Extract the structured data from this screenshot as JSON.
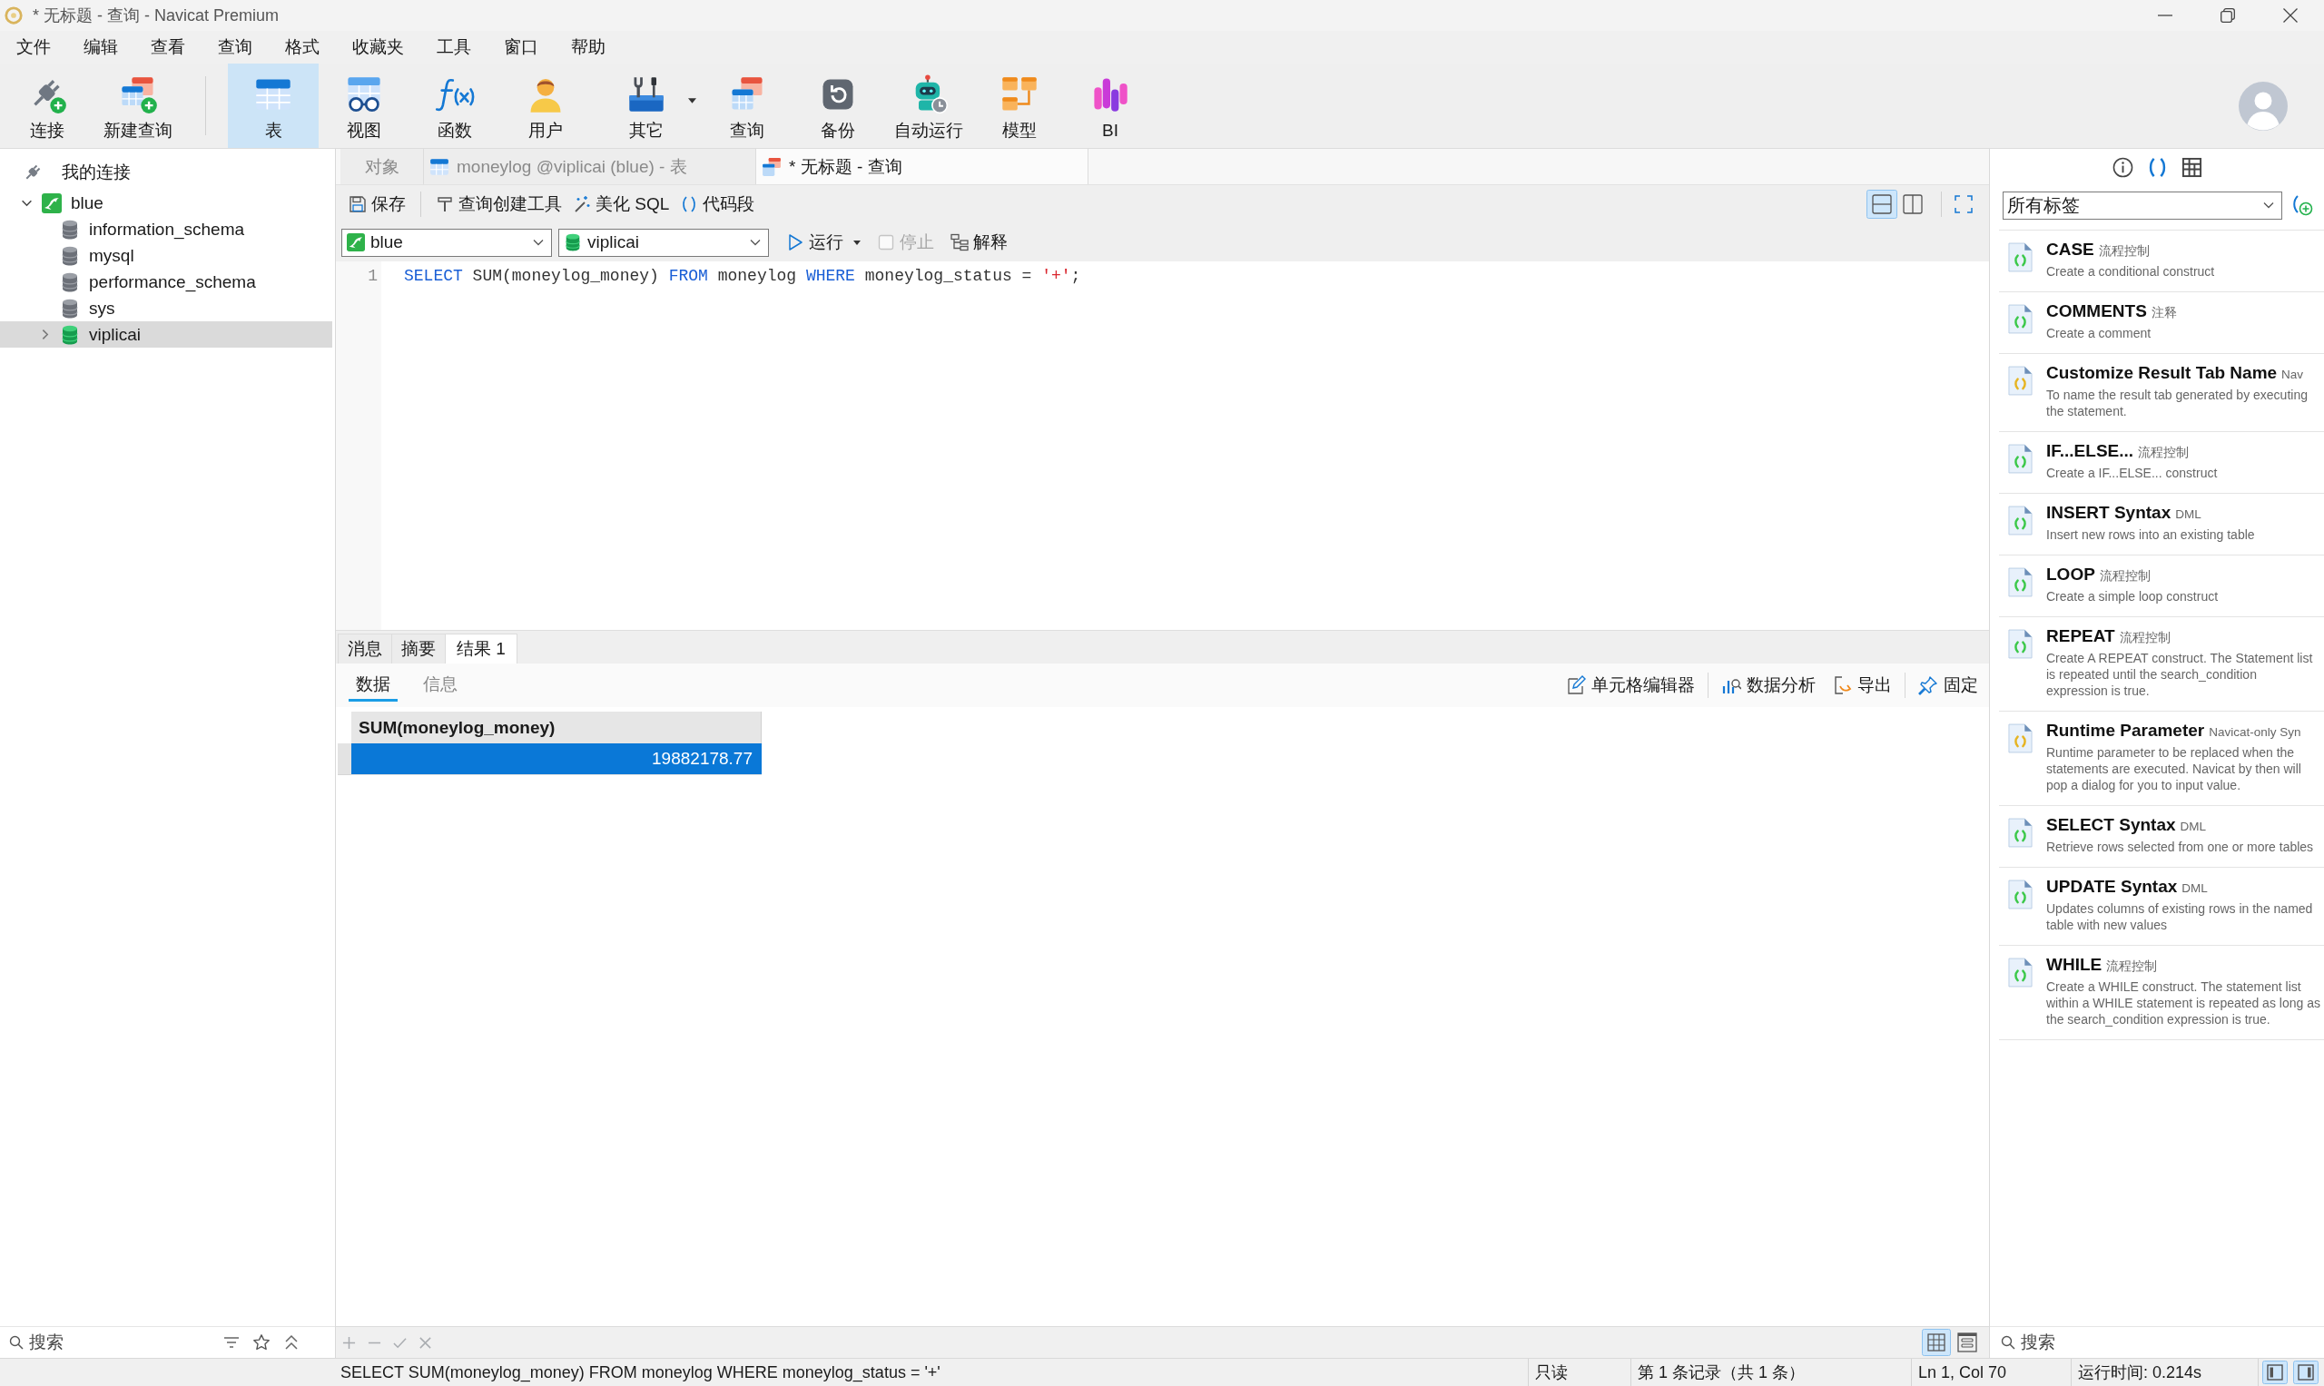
{
  "window": {
    "title": "* 无标题 - 查询 - Navicat Premium"
  },
  "menu": [
    "文件",
    "编辑",
    "查看",
    "查询",
    "格式",
    "收藏夹",
    "工具",
    "窗口",
    "帮助"
  ],
  "toolbar": {
    "connection_tools": [
      {
        "label": "连接",
        "selected": false,
        "dropdown": false
      },
      {
        "label": "新建查询",
        "selected": false,
        "dropdown": false
      }
    ],
    "object_tools": [
      {
        "label": "表",
        "selected": true,
        "dropdown": false
      },
      {
        "label": "视图",
        "selected": false,
        "dropdown": false
      },
      {
        "label": "函数",
        "selected": false,
        "dropdown": false
      },
      {
        "label": "用户",
        "selected": false,
        "dropdown": false
      },
      {
        "label": "其它",
        "selected": false,
        "dropdown": true
      },
      {
        "label": "查询",
        "selected": false,
        "dropdown": false
      },
      {
        "label": "备份",
        "selected": false,
        "dropdown": false
      },
      {
        "label": "自动运行",
        "selected": false,
        "dropdown": false
      },
      {
        "label": "模型",
        "selected": false,
        "dropdown": false
      },
      {
        "label": "BI",
        "selected": false,
        "dropdown": false
      }
    ]
  },
  "navigator": {
    "title": "我的连接",
    "connections": [
      {
        "label": "blue",
        "selected": false,
        "expanded": true,
        "children": [
          {
            "label": "information_schema",
            "open": false,
            "selected": false
          },
          {
            "label": "mysql",
            "open": false,
            "selected": false
          },
          {
            "label": "performance_schema",
            "open": false,
            "selected": false
          },
          {
            "label": "sys",
            "open": false,
            "selected": false
          },
          {
            "label": "viplicai",
            "open": true,
            "selected": true,
            "expanded": false
          }
        ]
      }
    ],
    "search": {
      "placeholder": "搜索"
    }
  },
  "editor": {
    "tabs": [
      {
        "label": "对象",
        "selected": false,
        "kind": "objects"
      },
      {
        "label": "moneylog @viplicai (blue) - 表",
        "selected": false,
        "kind": "table"
      },
      {
        "label": "* 无标题 - 查询",
        "selected": true,
        "kind": "query"
      }
    ],
    "actions": [
      "保存",
      "查询创建工具",
      "美化 SQL",
      "代码段"
    ],
    "layouts": [
      {
        "selected": true
      },
      {
        "selected": false
      }
    ],
    "connection": "blue",
    "database": "viplicai",
    "run_controls": [
      {
        "label": "运行",
        "disabled": false,
        "dropdown": true
      },
      {
        "label": "停止",
        "disabled": true,
        "dropdown": false
      },
      {
        "label": "解释",
        "disabled": false,
        "dropdown": false
      }
    ],
    "lines": [
      {
        "number": "1",
        "tokens": [
          {
            "text": "SELECT",
            "kind": "keyword"
          },
          {
            "text": " SUM(moneylog_money) ",
            "kind": "plain"
          },
          {
            "text": "FROM",
            "kind": "keyword"
          },
          {
            "text": " moneylog ",
            "kind": "plain"
          },
          {
            "text": "WHERE",
            "kind": "keyword"
          },
          {
            "text": " moneylog_status = ",
            "kind": "plain"
          },
          {
            "text": "'+'",
            "kind": "string"
          },
          {
            "text": ";",
            "kind": "plain"
          }
        ]
      }
    ]
  },
  "results": {
    "tabs": [
      {
        "label": "消息",
        "selected": false
      },
      {
        "label": "摘要",
        "selected": false
      },
      {
        "label": "结果 1",
        "selected": true
      }
    ],
    "subtabs": [
      {
        "label": "数据",
        "selected": true
      },
      {
        "label": "信息",
        "selected": false
      }
    ],
    "actions": [
      "单元格编辑器",
      "数据分析",
      "导出",
      "固定"
    ],
    "columns": [
      "SUM(moneylog_money)"
    ],
    "rows": [
      {
        "cells": [
          "19882178.77"
        ],
        "selected": true
      }
    ],
    "record_buttons": [
      {
        "disabled": true
      },
      {
        "disabled": true
      },
      {
        "disabled": true
      },
      {
        "disabled": true
      }
    ],
    "views": [
      {
        "selected": true
      },
      {
        "selected": false
      }
    ]
  },
  "snippets": {
    "panel_tabs": [
      {
        "selected": false
      },
      {
        "selected": true
      },
      {
        "selected": false
      }
    ],
    "filter": "所有标签",
    "items": [
      {
        "title": "CASE",
        "tag": "流程控制",
        "description": "Create a conditional construct",
        "kind": "sql"
      },
      {
        "title": "COMMENTS",
        "tag": "注释",
        "description": "Create a comment",
        "kind": "sql"
      },
      {
        "title": "Customize Result Tab Name",
        "tag": "Nav",
        "description": "To name the result tab generated by executing the statement.",
        "kind": "navicat"
      },
      {
        "title": "IF...ELSE...",
        "tag": "流程控制",
        "description": "Create a IF...ELSE... construct",
        "kind": "sql"
      },
      {
        "title": "INSERT Syntax",
        "tag": "DML",
        "description": "Insert new rows into an existing table",
        "kind": "sql"
      },
      {
        "title": "LOOP",
        "tag": "流程控制",
        "description": "Create a simple loop construct",
        "kind": "sql"
      },
      {
        "title": "REPEAT",
        "tag": "流程控制",
        "description": "Create A REPEAT construct. The Statement list is repeated until the search_condition expression is true.",
        "kind": "sql"
      },
      {
        "title": "Runtime Parameter",
        "tag": "Navicat-only Syn",
        "description": "Runtime parameter to be replaced when the statements are executed. Navicat by then will pop a dialog for you to input value.",
        "kind": "navicat"
      },
      {
        "title": "SELECT Syntax",
        "tag": "DML",
        "description": "Retrieve rows selected from one or more tables",
        "kind": "sql"
      },
      {
        "title": "UPDATE Syntax",
        "tag": "DML",
        "description": "Updates columns of existing rows in the named table with new values",
        "kind": "sql"
      },
      {
        "title": "WHILE",
        "tag": "流程控制",
        "description": "Create a WHILE construct. The statement list within a WHILE statement is repeated as long as the search_condition expression is true.",
        "kind": "sql"
      }
    ],
    "search": {
      "placeholder": "搜索"
    }
  },
  "status_bar": {
    "sql": "SELECT SUM(moneylog_money) FROM moneylog WHERE moneylog_status = '+'",
    "mode": "只读",
    "records": "第 1 条记录（共 1 条）",
    "cursor": "Ln 1, Col 70",
    "elapsed": "运行时间: 0.214s",
    "panel_toggles": [
      {
        "selected": true
      },
      {
        "selected": true
      }
    ]
  }
}
